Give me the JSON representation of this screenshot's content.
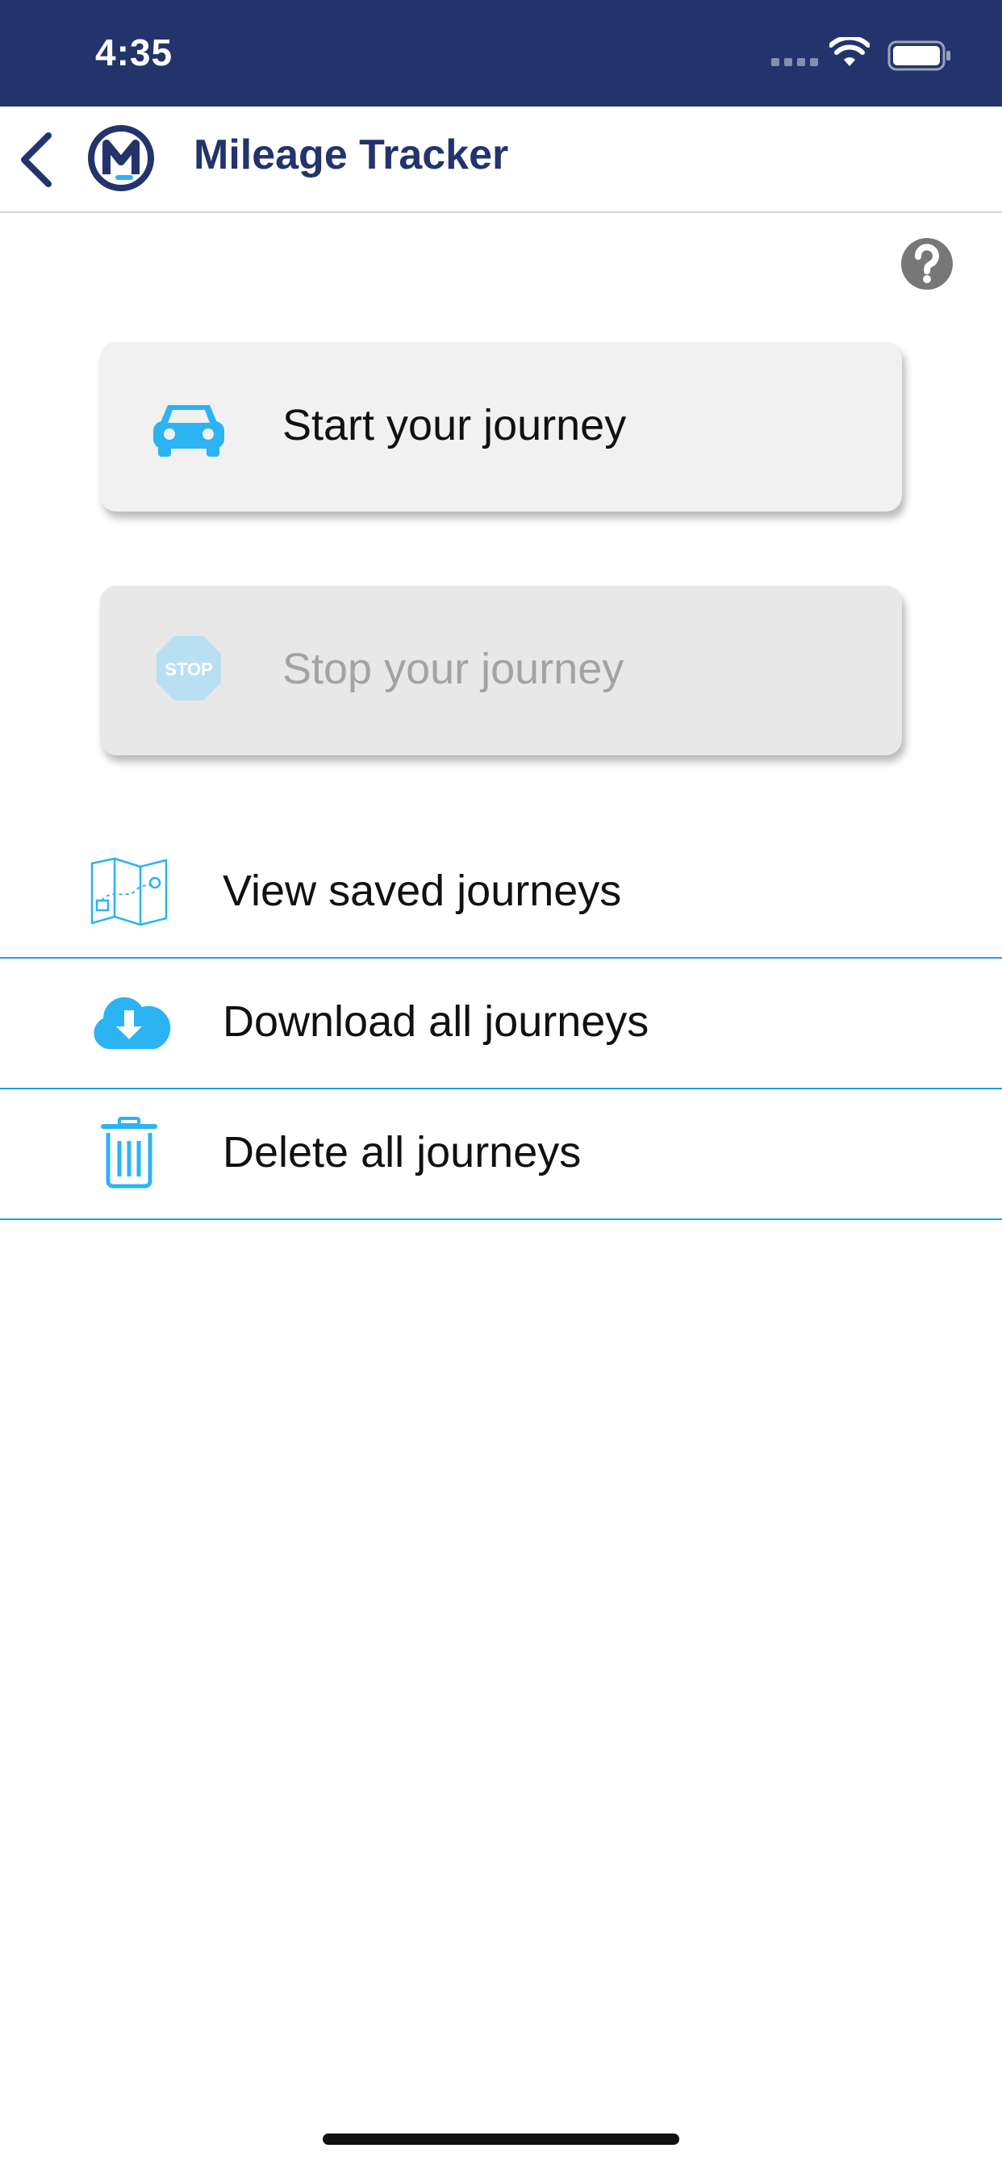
{
  "status_bar": {
    "time": "4:35",
    "icons": [
      "cellular-signal-icon",
      "wifi-icon",
      "battery-icon"
    ],
    "background": "#22346b"
  },
  "nav": {
    "title": "Mileage Tracker",
    "back_icon": "chevron-left-icon",
    "logo": "m-logo",
    "title_color": "#22346b"
  },
  "help": {
    "icon": "question-circle-icon"
  },
  "actions": {
    "start": {
      "label": "Start your journey",
      "icon": "car-icon",
      "enabled": true
    },
    "stop": {
      "label": "Stop your journey",
      "icon": "stop-sign-icon",
      "enabled": false
    }
  },
  "menu": [
    {
      "label": "View saved journeys",
      "icon": "map-icon"
    },
    {
      "label": "Download all journeys",
      "icon": "cloud-download-icon"
    },
    {
      "label": "Delete all journeys",
      "icon": "trash-icon"
    }
  ],
  "accent_color": "#2bb3f3"
}
